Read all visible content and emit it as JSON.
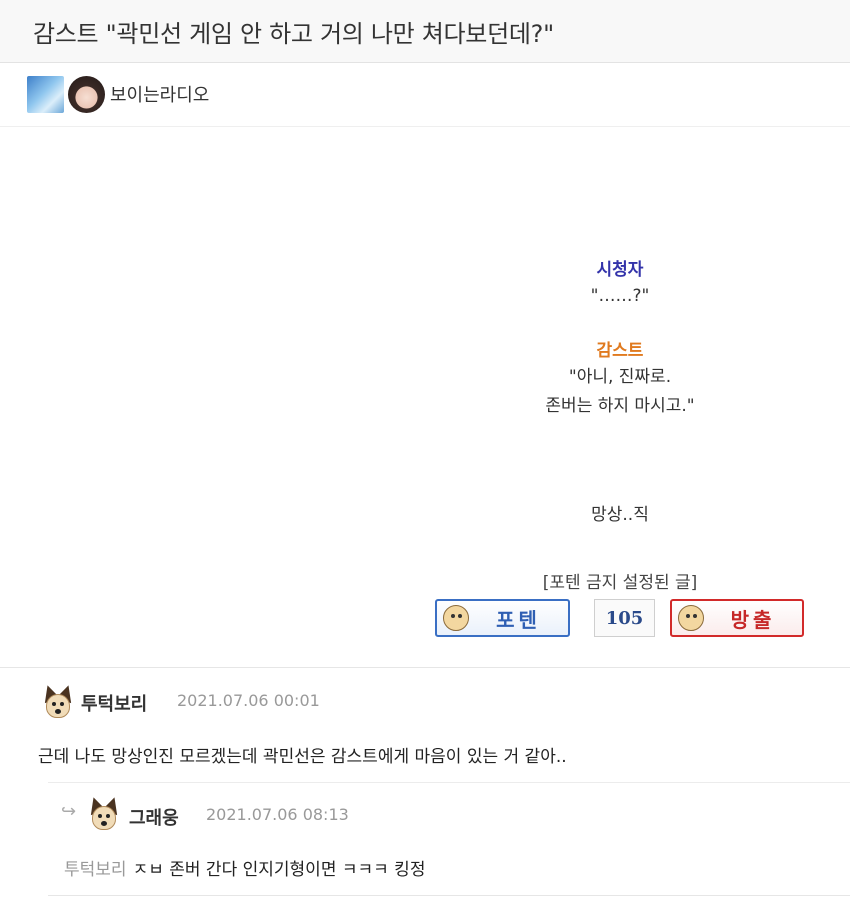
{
  "post": {
    "title": "감스트 \"곽민선 게임 안 하고 거의 나만 쳐다보던데?\"",
    "author": {
      "nickname": "보이는라디오",
      "level_icon": "level-badge-icon",
      "profile_icon": "profile-photo-icon"
    }
  },
  "content": {
    "speaker_a": "시청자",
    "speaker_a_color": "#3333aa",
    "line_a": "\"……?\"",
    "speaker_b": "감스트",
    "speaker_b_color": "#e07a1f",
    "line_b1": "\"아니, 진짜로.",
    "line_b2": "존버는 하지 마시고.\"",
    "line_c": "망상..직",
    "notice": "[포텐 금지 설정된 글]"
  },
  "votes": {
    "potten_label": "포텐",
    "count": "105",
    "banchul_label": "방출"
  },
  "comments": [
    {
      "nickname": "투턱보리",
      "date": "2021.07.06 00:01",
      "text": "근데 나도 망상인진 모르겠는데 곽민선은 감스트에게 마음이 있는 거 같아.."
    },
    {
      "nickname": "그래웅",
      "date": "2021.07.06 08:13",
      "mention": "투턱보리",
      "text": "ㅈㅂ 존버 간다 인지기형이면 ㅋㅋㅋ 킹정"
    }
  ],
  "colors": {
    "accent_blue": "#3a6fc4",
    "accent_red": "#d22a2a",
    "muted": "#999999"
  }
}
